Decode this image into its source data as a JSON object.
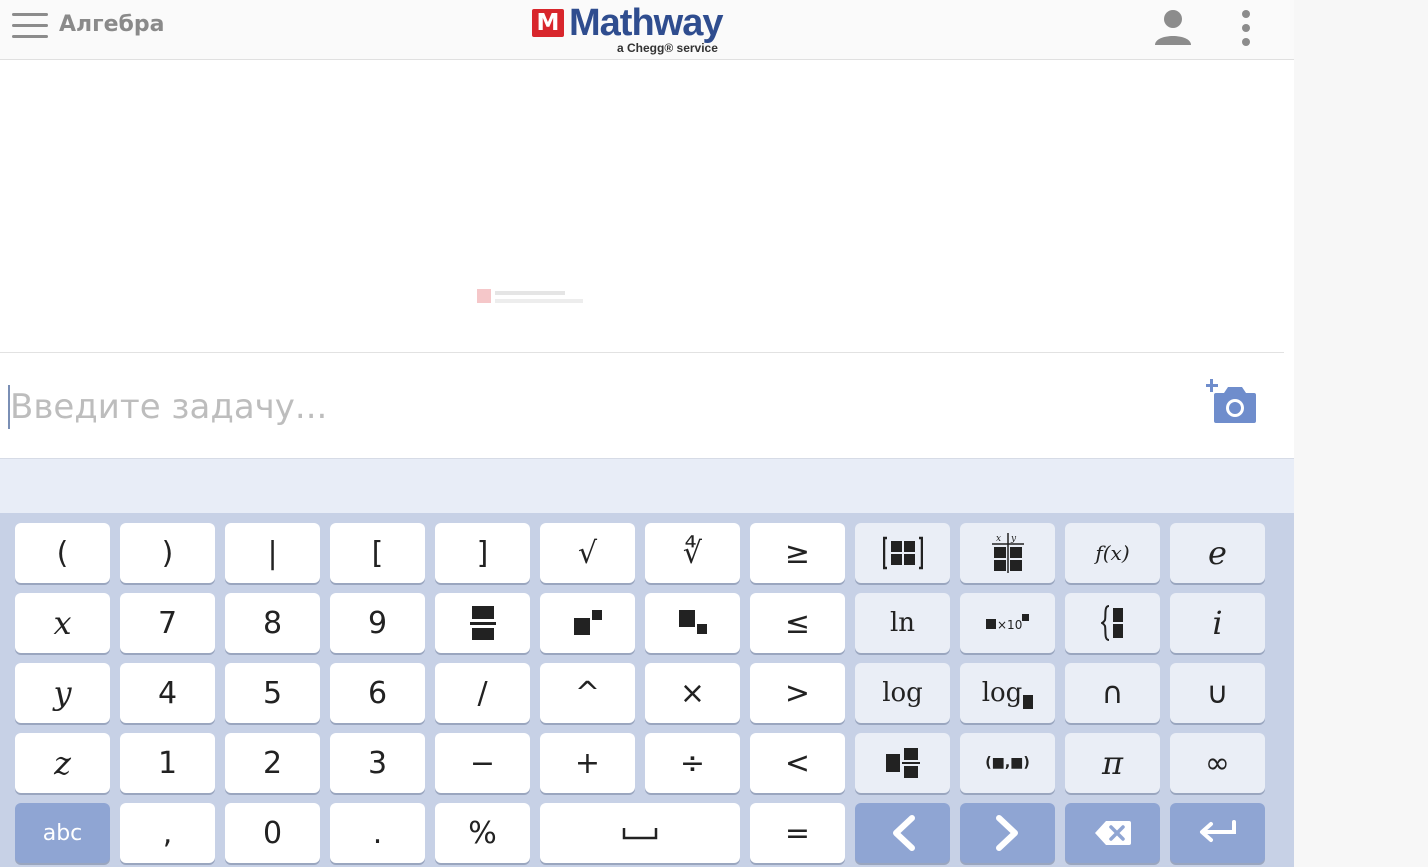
{
  "header": {
    "subject": "Алгебра",
    "logo_mark": "M",
    "logo_word": "Mathway",
    "logo_sub": "a Chegg® service",
    "accent": "#2f4d8f",
    "brand_red": "#d8262c"
  },
  "input": {
    "placeholder": "Введите задачу...",
    "value": ""
  },
  "keyboard": {
    "rows": [
      [
        {
          "label": "(",
          "name": "open-paren-key",
          "style": "white",
          "font": "sans"
        },
        {
          "label": ")",
          "name": "close-paren-key",
          "style": "white",
          "font": "sans"
        },
        {
          "label": "|",
          "name": "abs-bar-key",
          "style": "white",
          "font": "sans"
        },
        {
          "label": "[",
          "name": "open-bracket-key",
          "style": "white",
          "font": "sans"
        },
        {
          "label": "]",
          "name": "close-bracket-key",
          "style": "white",
          "font": "sans"
        },
        {
          "label": "√",
          "name": "sqrt-key",
          "style": "white",
          "font": "sans"
        },
        {
          "label": "∜",
          "name": "nth-root-key",
          "style": "white",
          "font": "sans"
        },
        {
          "label": "≥",
          "name": "greater-equal-key",
          "style": "white",
          "font": "sans"
        },
        {
          "label": "",
          "name": "matrix-key",
          "style": "light",
          "icon": "matrix-icon"
        },
        {
          "label": "",
          "name": "table-key",
          "style": "light",
          "icon": "xy-table-icon"
        },
        {
          "label": "f(x)",
          "name": "function-key",
          "style": "light",
          "font": "serif-sm"
        },
        {
          "label": "e",
          "name": "euler-key",
          "style": "light",
          "font": "serif-i"
        }
      ],
      [
        {
          "label": "x",
          "name": "x-key",
          "style": "white",
          "font": "serif-i"
        },
        {
          "label": "7",
          "name": "digit-7-key",
          "style": "white",
          "font": "sans"
        },
        {
          "label": "8",
          "name": "digit-8-key",
          "style": "white",
          "font": "sans"
        },
        {
          "label": "9",
          "name": "digit-9-key",
          "style": "white",
          "font": "sans"
        },
        {
          "label": "",
          "name": "fraction-key",
          "style": "white",
          "icon": "fraction-icon"
        },
        {
          "label": "",
          "name": "superscript-key",
          "style": "white",
          "icon": "superscript-icon"
        },
        {
          "label": "",
          "name": "subscript-key",
          "style": "white",
          "icon": "subscript-icon"
        },
        {
          "label": "≤",
          "name": "less-equal-key",
          "style": "white",
          "font": "sans"
        },
        {
          "label": "ln",
          "name": "ln-key",
          "style": "light",
          "font": "serif"
        },
        {
          "label": "×10",
          "name": "sci-notation-key",
          "style": "light",
          "icon": "sci-notation-icon"
        },
        {
          "label": "",
          "name": "piecewise-key",
          "style": "light",
          "icon": "piecewise-icon"
        },
        {
          "label": "i",
          "name": "imaginary-key",
          "style": "light",
          "font": "serif-i"
        }
      ],
      [
        {
          "label": "y",
          "name": "y-key",
          "style": "white",
          "font": "serif-i"
        },
        {
          "label": "4",
          "name": "digit-4-key",
          "style": "white",
          "font": "sans"
        },
        {
          "label": "5",
          "name": "digit-5-key",
          "style": "white",
          "font": "sans"
        },
        {
          "label": "6",
          "name": "digit-6-key",
          "style": "white",
          "font": "sans"
        },
        {
          "label": "/",
          "name": "slash-key",
          "style": "white",
          "font": "sans"
        },
        {
          "label": "^",
          "name": "caret-key",
          "style": "white",
          "font": "sans"
        },
        {
          "label": "×",
          "name": "multiply-key",
          "style": "white",
          "font": "sans"
        },
        {
          "label": ">",
          "name": "greater-key",
          "style": "white",
          "font": "sans"
        },
        {
          "label": "log",
          "name": "log-key",
          "style": "light",
          "font": "serif"
        },
        {
          "label": "log",
          "name": "log-base-key",
          "style": "light",
          "icon": "log-base-icon"
        },
        {
          "label": "∩",
          "name": "intersection-key",
          "style": "light",
          "font": "sans"
        },
        {
          "label": "∪",
          "name": "union-key",
          "style": "light",
          "font": "sans"
        }
      ],
      [
        {
          "label": "z",
          "name": "z-key",
          "style": "white",
          "font": "serif-i"
        },
        {
          "label": "1",
          "name": "digit-1-key",
          "style": "white",
          "font": "sans"
        },
        {
          "label": "2",
          "name": "digit-2-key",
          "style": "white",
          "font": "sans"
        },
        {
          "label": "3",
          "name": "digit-3-key",
          "style": "white",
          "font": "sans"
        },
        {
          "label": "−",
          "name": "minus-key",
          "style": "white",
          "font": "sans"
        },
        {
          "label": "+",
          "name": "plus-key",
          "style": "white",
          "font": "sans"
        },
        {
          "label": "÷",
          "name": "divide-key",
          "style": "white",
          "font": "sans"
        },
        {
          "label": "<",
          "name": "less-key",
          "style": "white",
          "font": "sans"
        },
        {
          "label": "",
          "name": "mixed-number-key",
          "style": "light",
          "icon": "mixed-number-icon"
        },
        {
          "label": "",
          "name": "ordered-pair-key",
          "style": "light",
          "icon": "ordered-pair-icon"
        },
        {
          "label": "π",
          "name": "pi-key",
          "style": "light",
          "font": "serif-i"
        },
        {
          "label": "∞",
          "name": "infinity-key",
          "style": "light",
          "font": "sans"
        }
      ],
      [
        {
          "label": "abc",
          "name": "abc-key",
          "style": "blue",
          "font": "small"
        },
        {
          "label": ",",
          "name": "comma-key",
          "style": "white",
          "font": "sans"
        },
        {
          "label": "0",
          "name": "digit-0-key",
          "style": "white",
          "font": "sans"
        },
        {
          "label": ".",
          "name": "period-key",
          "style": "white",
          "font": "sans"
        },
        {
          "label": "%",
          "name": "percent-key",
          "style": "white",
          "font": "sans"
        },
        {
          "label": "",
          "name": "space-key",
          "style": "white",
          "icon": "space-icon",
          "wide": true
        },
        {
          "label": "=",
          "name": "equals-key",
          "style": "white",
          "font": "sans"
        },
        {
          "label": "",
          "name": "cursor-left-key",
          "style": "blue",
          "icon": "chevron-left-icon"
        },
        {
          "label": "",
          "name": "cursor-right-key",
          "style": "blue",
          "icon": "chevron-right-icon"
        },
        {
          "label": "",
          "name": "backspace-key",
          "style": "blue",
          "icon": "backspace-icon"
        },
        {
          "label": "",
          "name": "enter-key",
          "style": "blue",
          "icon": "enter-icon"
        }
      ]
    ]
  }
}
